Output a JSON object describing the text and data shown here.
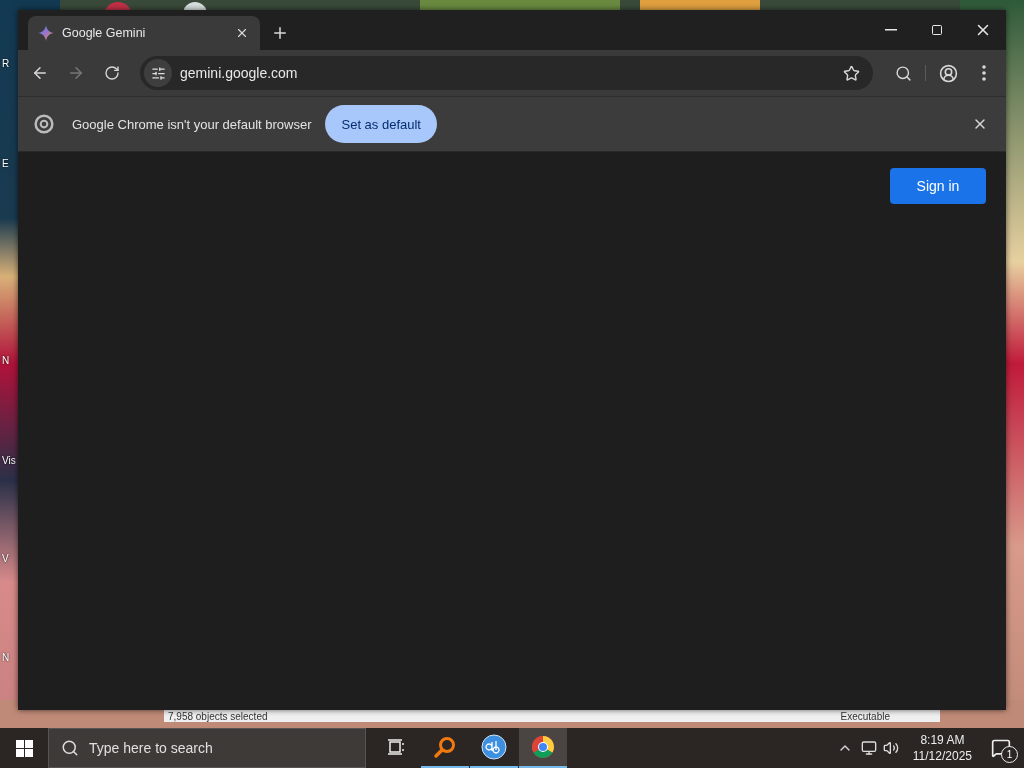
{
  "desktop_icons": [
    {
      "label": "R"
    },
    {
      "label": "E"
    },
    {
      "label": "N"
    },
    {
      "label": "Vis"
    },
    {
      "label": "V"
    },
    {
      "label": "N"
    }
  ],
  "background_window": {
    "status": "7,958 objects selected",
    "column": "Executable"
  },
  "browser": {
    "tabs": [
      {
        "title": "Google Gemini",
        "selected": true
      }
    ],
    "address": "gemini.google.com",
    "infobar": {
      "message": "Google Chrome isn't your default browser",
      "button": "Set as default"
    },
    "page": {
      "button": "Sign in"
    }
  },
  "taskbar": {
    "search_placeholder": "Type here to search",
    "apps": [
      {
        "kind": "task-view",
        "running": false,
        "selected": false
      },
      {
        "kind": "magnifier",
        "running": true,
        "selected": false
      },
      {
        "kind": "qb",
        "running": true,
        "selected": false
      },
      {
        "kind": "chrome",
        "running": true,
        "selected": true
      }
    ],
    "time": "8:19 AM",
    "date": "11/12/2025",
    "notifications": "1"
  }
}
